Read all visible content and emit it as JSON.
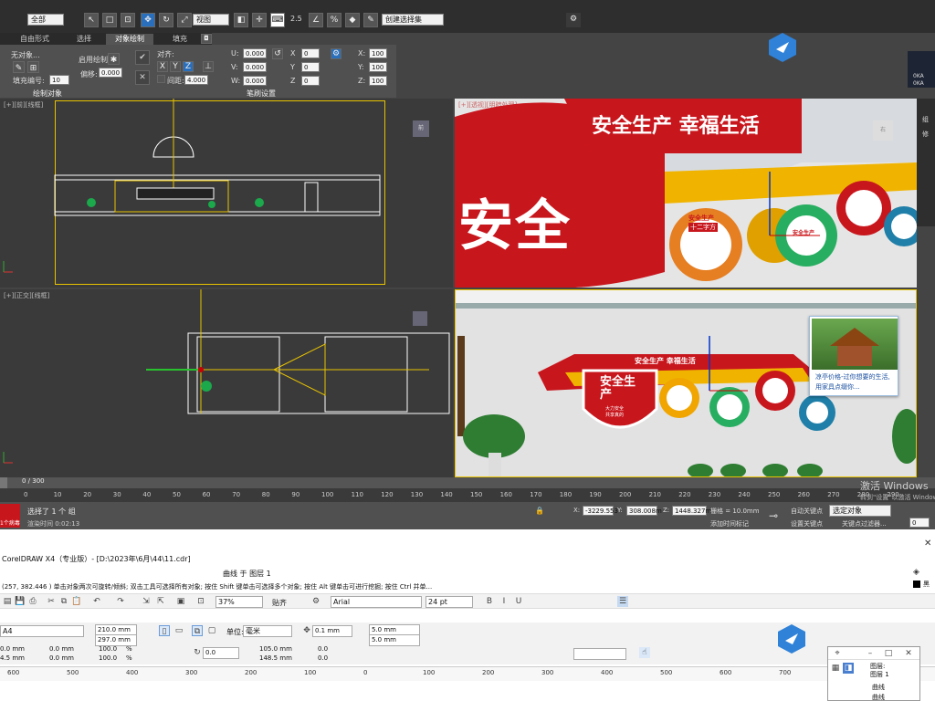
{
  "max": {
    "toolbar": {
      "selection_filter": "全部",
      "view_dropdown": "视图",
      "snap_value": "2.5",
      "named_selection_placeholder": "创建选择集"
    },
    "tabs": [
      "自由形式",
      "选择",
      "对象绘制",
      "填充"
    ],
    "active_tab": "对象绘制",
    "ribbon": {
      "no_object": "无对象...",
      "fill_label": "填充编号:",
      "fill_value": "10",
      "enable_draw": "启用绘制:",
      "offset_label": "偏移:",
      "offset_value": "0.000",
      "align_label": "对齐:",
      "x_btn": "X",
      "y_btn": "Y",
      "z_btn": "Z",
      "normal_label": "法线",
      "spacing_label": "间距:",
      "spacing_value": "4.000",
      "u_label": "U:",
      "v_label": "V:",
      "w_label": "W:",
      "uvw_value": "0.000",
      "x_label": "X",
      "y_label": "Y",
      "z_label": "Z",
      "xyz_value": "0",
      "scale_x_label": "X:",
      "scale_y_label": "Y:",
      "scale_z_label": "Z:",
      "scale_value": "100",
      "section_draw": "绘制对象",
      "section_brush": "笔刷设置"
    },
    "viewports": {
      "top_left": "[+][前][线框]",
      "top_right": "[+][透视][明暗处理]",
      "bottom_left": "[+][正交][线框]",
      "top_right_cube": "右",
      "top_left_cube": "前"
    },
    "render_top": {
      "slogan": "安全生产  幸福生活",
      "big_text": "安全",
      "gear1_title": "安全生产",
      "gear1_sub": "十二字方",
      "gear2_title": "安全生产"
    },
    "render_bottom": {
      "slogan": "安全生产  幸福生活",
      "shield_text": "安全生产",
      "shield_sub1": "大力安全",
      "shield_sub2": "共享真的"
    },
    "ad_popup": {
      "text": "凉亭价格-过你想要的生活,用家具点缀你..."
    },
    "timeline": {
      "frame": "0 / 300",
      "ticks": [
        "0",
        "10",
        "20",
        "30",
        "40",
        "50",
        "60",
        "70",
        "80",
        "90",
        "100",
        "110",
        "120",
        "130",
        "140",
        "150",
        "160",
        "170",
        "180",
        "190",
        "200",
        "210",
        "220",
        "230",
        "240",
        "250",
        "260",
        "270",
        "280",
        "290"
      ]
    },
    "status": {
      "left_tag": "1个病毒",
      "selection_text": "选择了 1 个 组",
      "hint_text": "渲染时间 0:02:13",
      "x_label": "X:",
      "x_value": "-3229.553",
      "y_label": "Y:",
      "y_value": "308.008m",
      "z_label": "Z:",
      "z_value": "1448.327m",
      "grid": "栅格 = 10.0mm",
      "add_time_tag": "添加时间标记",
      "auto_key": "自动关键点",
      "selected_object": "选定对象",
      "set_key": "设置关键点",
      "key_filter": "关键点过滤器...",
      "frame_value": "0"
    },
    "activate_windows": {
      "title": "激活 Windows",
      "subtitle": "转到\"设置\"以激活 Windows。"
    },
    "side_labels": [
      "0KA",
      "0KA",
      "组",
      "修"
    ]
  },
  "corel": {
    "title": "CorelDRAW X4（专业版）- [D:\\2023年\\6月\\44\\11.cdr]",
    "layer_info": "曲线 于 图层 1",
    "hint": "(257, 382.446 ) 单击对象两次可旋转/倾斜; 双击工具可选择所有对象; 按住 Shift 键单击可选择多个对象; 按住 Alt 键单击可进行挖掘; 按住 Ctrl 并单...",
    "zoom": "37%",
    "paste_label": "贴齐",
    "font_name": "Arial",
    "font_size": "24 pt",
    "page_size": "A4",
    "width": "210.0 mm",
    "height": "297.0 mm",
    "unit_label": "单位:",
    "unit_value": "毫米",
    "nudge": "0.1 mm",
    "dup_x": "5.0 mm",
    "dup_y": "5.0 mm",
    "pos_x": "0.0 mm",
    "pos_y": "4.5 mm",
    "size_w": "0.0 mm",
    "size_h": "0.0 mm",
    "scale_w": "100.0",
    "scale_h": "100.0",
    "percent": "%",
    "angle": "0.0",
    "center_x": "105.0 mm",
    "center_y": "148.5 mm",
    "ruler_ticks": [
      "600",
      "500",
      "400",
      "300",
      "200",
      "100",
      "0",
      "100",
      "200",
      "300",
      "400",
      "500",
      "600",
      "700",
      "800"
    ],
    "panel": {
      "item_a": "图层:",
      "item_b": "图层 1",
      "curve1": "曲线",
      "curve2": "曲线"
    },
    "color_label": "黑"
  },
  "colors": {
    "max_bg": "#444444",
    "viewport": "#3a3a3a",
    "red": "#c8161d",
    "yellow": "#f1c40f",
    "corel_bg": "#ffffff"
  }
}
